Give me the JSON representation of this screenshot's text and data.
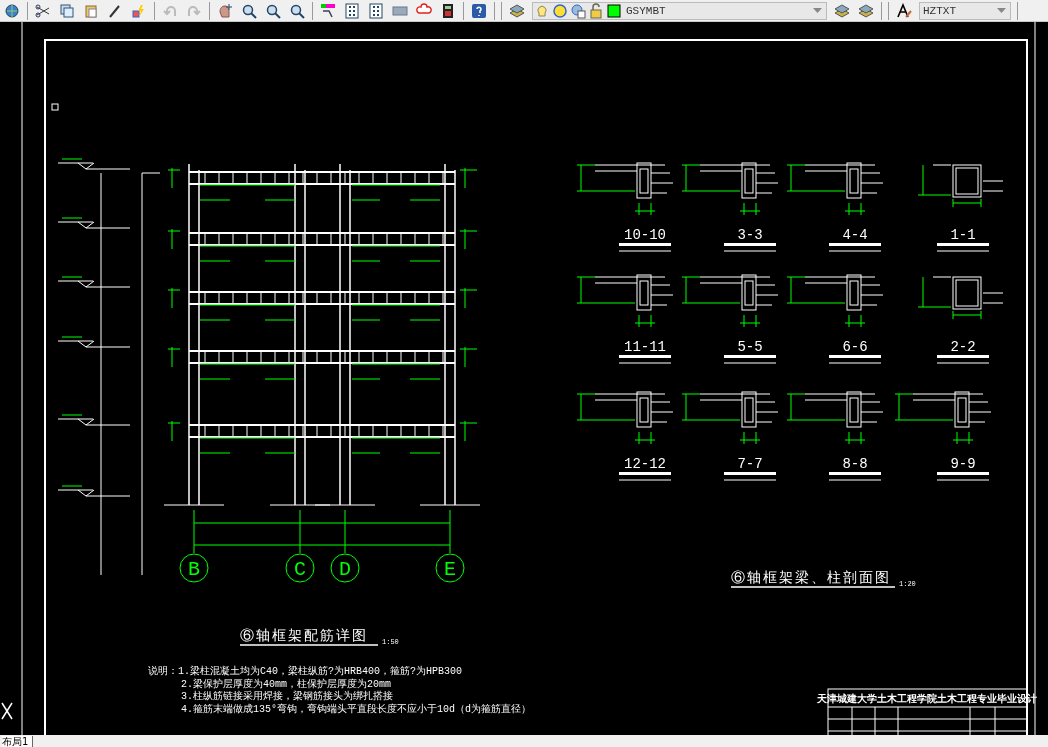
{
  "toolbar": {
    "layer": "GSYMBT",
    "text_style": "HZTXT"
  },
  "frame_elevation": {
    "axes": [
      "B",
      "C",
      "D",
      "E"
    ],
    "title": "⑥轴框架配筋详图",
    "scale": "1:50"
  },
  "sections": {
    "title": "⑥轴框架梁、柱剖面图",
    "scale": "1:20",
    "items": [
      {
        "label": "10-10",
        "kind": "beam"
      },
      {
        "label": "3-3",
        "kind": "beam"
      },
      {
        "label": "4-4",
        "kind": "beam"
      },
      {
        "label": "1-1",
        "kind": "column"
      },
      {
        "label": "11-11",
        "kind": "beam"
      },
      {
        "label": "5-5",
        "kind": "beam"
      },
      {
        "label": "6-6",
        "kind": "beam"
      },
      {
        "label": "2-2",
        "kind": "column"
      },
      {
        "label": "12-12",
        "kind": "beam"
      },
      {
        "label": "7-7",
        "kind": "beam"
      },
      {
        "label": "8-8",
        "kind": "beam"
      },
      {
        "label": "9-9",
        "kind": "beam"
      }
    ]
  },
  "notes": [
    "说明：1.梁柱混凝土均为C40，梁柱纵筋?为HRB400，箍筋?为HPB300",
    "2.梁保护层厚度为40mm，柱保护层厚度为20mm",
    "3.柱纵筋链接采用焊接，梁钢筋接头为绑扎搭接",
    "4.箍筋末端做成135°弯钩，弯钩端头平直段长度不应小于10d（d为箍筋直径）"
  ],
  "title_block": {
    "heading": "天津城建大学土木工程学院土木工程专业毕业设计"
  },
  "layout_tabs": [
    {
      "label": "布局1"
    }
  ]
}
